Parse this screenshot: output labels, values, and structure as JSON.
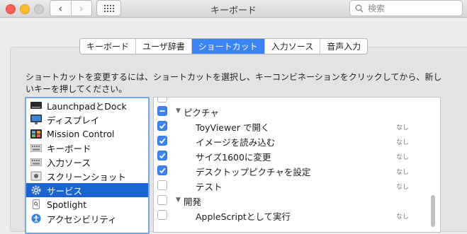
{
  "window": {
    "title": "キーボード"
  },
  "search": {
    "placeholder": "検索"
  },
  "tabs": [
    {
      "label": "キーボード"
    },
    {
      "label": "ユーザ辞書"
    },
    {
      "label": "ショートカット"
    },
    {
      "label": "入力ソース"
    },
    {
      "label": "音声入力"
    }
  ],
  "instruction": "ショートカットを変更するには、ショートカットを選択し、キーコンビネーションをクリックしてから、新しいキーを押してください。",
  "categories": [
    {
      "label": "LaunchpadとDock"
    },
    {
      "label": "ディスプレイ"
    },
    {
      "label": "Mission Control"
    },
    {
      "label": "キーボード"
    },
    {
      "label": "入力ソース"
    },
    {
      "label": "スクリーンショット"
    },
    {
      "label": "サービス"
    },
    {
      "label": "Spotlight"
    },
    {
      "label": "アクセシビリティ"
    }
  ],
  "shortcuts": {
    "group1": "ピクチャ",
    "items": [
      {
        "label": "ToyViewer で開く",
        "key": "なし"
      },
      {
        "label": "イメージを読み込む",
        "key": "なし"
      },
      {
        "label": "サイズ1600に変更",
        "key": "なし"
      },
      {
        "label": "デスクトップピクチャを設定",
        "key": "なし"
      },
      {
        "label": "テスト",
        "key": "なし"
      }
    ],
    "group2": "開発",
    "item6": {
      "label": "AppleScriptとして実行",
      "key": "なし"
    }
  }
}
